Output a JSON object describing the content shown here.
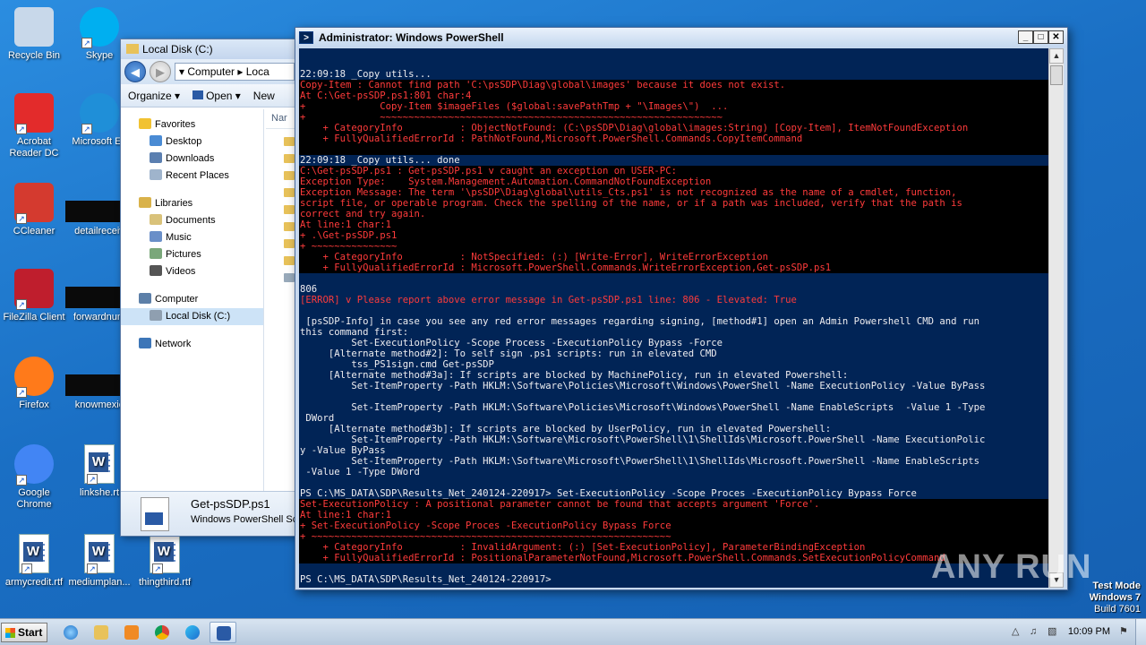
{
  "desktop_icons": [
    {
      "label": "Recycle Bin",
      "icon": "recycle-bin-icon"
    },
    {
      "label": "Skype",
      "icon": "skype-icon"
    },
    {
      "label": "Acrobat Reader DC",
      "icon": "acrobat-icon"
    },
    {
      "label": "Microsoft Ed",
      "icon": "edge-icon"
    },
    {
      "label": "CCleaner",
      "icon": "ccleaner-icon"
    },
    {
      "label": "detailreceiv",
      "icon": "file-icon"
    },
    {
      "label": "FileZilla Client",
      "icon": "filezilla-icon"
    },
    {
      "label": "forwardnum",
      "icon": "file-icon"
    },
    {
      "label": "Firefox",
      "icon": "firefox-icon"
    },
    {
      "label": "knowmexic",
      "icon": "file-icon"
    },
    {
      "label": "Google Chrome",
      "icon": "chrome-icon"
    },
    {
      "label": "linkshe.rt",
      "icon": "word-doc-icon"
    },
    {
      "label": "armycredit.rtf",
      "icon": "word-doc-icon"
    },
    {
      "label": "mediumplan...",
      "icon": "word-doc-icon"
    },
    {
      "label": "thingthird.rtf",
      "icon": "word-doc-icon"
    }
  ],
  "explorer": {
    "title": "Local Disk (C:)",
    "breadcrumb": [
      "Computer",
      "Loca"
    ],
    "toolbar": {
      "organize": "Organize",
      "open": "Open",
      "new": "New"
    },
    "nav": {
      "favorites": "Favorites",
      "favorites_items": [
        "Desktop",
        "Downloads",
        "Recent Places"
      ],
      "libraries": "Libraries",
      "libraries_items": [
        "Documents",
        "Music",
        "Pictures",
        "Videos"
      ],
      "computer": "Computer",
      "computer_items": [
        "Local Disk (C:)"
      ],
      "network": "Network"
    },
    "column_header": "Nar",
    "details": {
      "name": "Get-psSDP.ps1",
      "type": "Windows PowerShell Scr"
    }
  },
  "powershell": {
    "title": "Administrator: Windows PowerShell",
    "lines": [
      {
        "t": "22:09:18 _Copy utils...",
        "k": "n"
      },
      {
        "t": "Copy-Item : Cannot find path 'C:\\psSDP\\Diag\\global\\images' because it does not exist.",
        "k": "e"
      },
      {
        "t": "At C:\\Get-psSDP.ps1:801 char:4",
        "k": "e"
      },
      {
        "t": "+             Copy-Item $imageFiles ($global:savePathTmp + \"\\Images\\\")  ...",
        "k": "e"
      },
      {
        "t": "+             ~~~~~~~~~~~~~~~~~~~~~~~~~~~~~~~~~~~~~~~~~~~~~~~~~~~~~~~~~~~~",
        "k": "e"
      },
      {
        "t": "    + CategoryInfo          : ObjectNotFound: (C:\\psSDP\\Diag\\global\\images:String) [Copy-Item], ItemNotFoundException",
        "k": "e"
      },
      {
        "t": "    + FullyQualifiedErrorId : PathNotFound,Microsoft.PowerShell.Commands.CopyItemCommand",
        "k": "e"
      },
      {
        "t": "",
        "k": "e"
      },
      {
        "t": "22:09:18 _Copy utils... done",
        "k": "n"
      },
      {
        "t": "C:\\Get-psSDP.ps1 : Get-psSDP.ps1 v caught an exception on USER-PC:",
        "k": "e"
      },
      {
        "t": "Exception Type:    System.Management.Automation.CommandNotFoundException",
        "k": "e"
      },
      {
        "t": "Exception Message: The term '\\psSDP\\Diag\\global\\utils_Cts.ps1' is not recognized as the name of a cmdlet, function,",
        "k": "e"
      },
      {
        "t": "script file, or operable program. Check the spelling of the name, or if a path was included, verify that the path is",
        "k": "e"
      },
      {
        "t": "correct and try again.",
        "k": "e"
      },
      {
        "t": "At line:1 char:1",
        "k": "e"
      },
      {
        "t": "+ .\\Get-psSDP.ps1",
        "k": "e"
      },
      {
        "t": "+ ~~~~~~~~~~~~~~~",
        "k": "e"
      },
      {
        "t": "    + CategoryInfo          : NotSpecified: (:) [Write-Error], WriteErrorException",
        "k": "e"
      },
      {
        "t": "    + FullyQualifiedErrorId : Microsoft.PowerShell.Commands.WriteErrorException,Get-psSDP.ps1",
        "k": "e"
      },
      {
        "t": "",
        "k": "b"
      },
      {
        "t": "806",
        "k": "n"
      },
      {
        "t": "[ERROR] v Please report above error message in Get-psSDP.ps1 line: 806 - Elevated: True",
        "k": "e2"
      },
      {
        "t": "",
        "k": "b"
      },
      {
        "t": " [psSDP-Info] in case you see any red error messages regarding signing, [method#1] open an Admin Powershell CMD and run",
        "k": "n"
      },
      {
        "t": "this command first:",
        "k": "n"
      },
      {
        "t": "         Set-ExecutionPolicy -Scope Process -ExecutionPolicy Bypass -Force",
        "k": "n"
      },
      {
        "t": "     [Alternate method#2]: To self sign .ps1 scripts: run in elevated CMD",
        "k": "n"
      },
      {
        "t": "         tss_PS1sign.cmd Get-psSDP",
        "k": "n"
      },
      {
        "t": "     [Alternate method#3a]: If scripts are blocked by MachinePolicy, run in elevated Powershell:",
        "k": "n"
      },
      {
        "t": "         Set-ItemProperty -Path HKLM:\\Software\\Policies\\Microsoft\\Windows\\PowerShell -Name ExecutionPolicy -Value ByPass",
        "k": "n"
      },
      {
        "t": "",
        "k": "b"
      },
      {
        "t": "         Set-ItemProperty -Path HKLM:\\Software\\Policies\\Microsoft\\Windows\\PowerShell -Name EnableScripts  -Value 1 -Type",
        "k": "n"
      },
      {
        "t": " DWord",
        "k": "n"
      },
      {
        "t": "     [Alternate method#3b]: If scripts are blocked by UserPolicy, run in elevated Powershell:",
        "k": "n"
      },
      {
        "t": "         Set-ItemProperty -Path HKLM:\\Software\\Microsoft\\PowerShell\\1\\ShellIds\\Microsoft.PowerShell -Name ExecutionPolic",
        "k": "n"
      },
      {
        "t": "y -Value ByPass",
        "k": "n"
      },
      {
        "t": "         Set-ItemProperty -Path HKLM:\\Software\\Microsoft\\PowerShell\\1\\ShellIds\\Microsoft.PowerShell -Name EnableScripts",
        "k": "n"
      },
      {
        "t": " -Value 1 -Type DWord",
        "k": "n"
      },
      {
        "t": "",
        "k": "b"
      },
      {
        "t": "PS C:\\MS_DATA\\SDP\\Results_Net_240124-220917> Set-ExecutionPolicy -Scope Proces -ExecutionPolicy Bypass Force",
        "k": "n"
      },
      {
        "t": "Set-ExecutionPolicy : A positional parameter cannot be found that accepts argument 'Force'.",
        "k": "e"
      },
      {
        "t": "At line:1 char:1",
        "k": "e"
      },
      {
        "t": "+ Set-ExecutionPolicy -Scope Proces -ExecutionPolicy Bypass Force",
        "k": "e"
      },
      {
        "t": "+ ~~~~~~~~~~~~~~~~~~~~~~~~~~~~~~~~~~~~~~~~~~~~~~~~~~~~~~~~~~~~~~~",
        "k": "e"
      },
      {
        "t": "    + CategoryInfo          : InvalidArgument: (:) [Set-ExecutionPolicy], ParameterBindingException",
        "k": "e"
      },
      {
        "t": "    + FullyQualifiedErrorId : PositionalParameterNotFound,Microsoft.PowerShell.Commands.SetExecutionPolicyCommand",
        "k": "e"
      },
      {
        "t": "",
        "k": "b"
      },
      {
        "t": "PS C:\\MS_DATA\\SDP\\Results_Net_240124-220917>",
        "k": "n"
      }
    ]
  },
  "watermark": "ANY RUN",
  "test_mode": {
    "line1": "Test Mode",
    "line2": "Windows 7",
    "line3": "Build 7601"
  },
  "taskbar": {
    "start": "Start",
    "clock": "10:09 PM"
  },
  "colors": {
    "console_bg": "#012456",
    "error_fg": "#ff3b3b",
    "desktop": "#1a6fc4"
  }
}
